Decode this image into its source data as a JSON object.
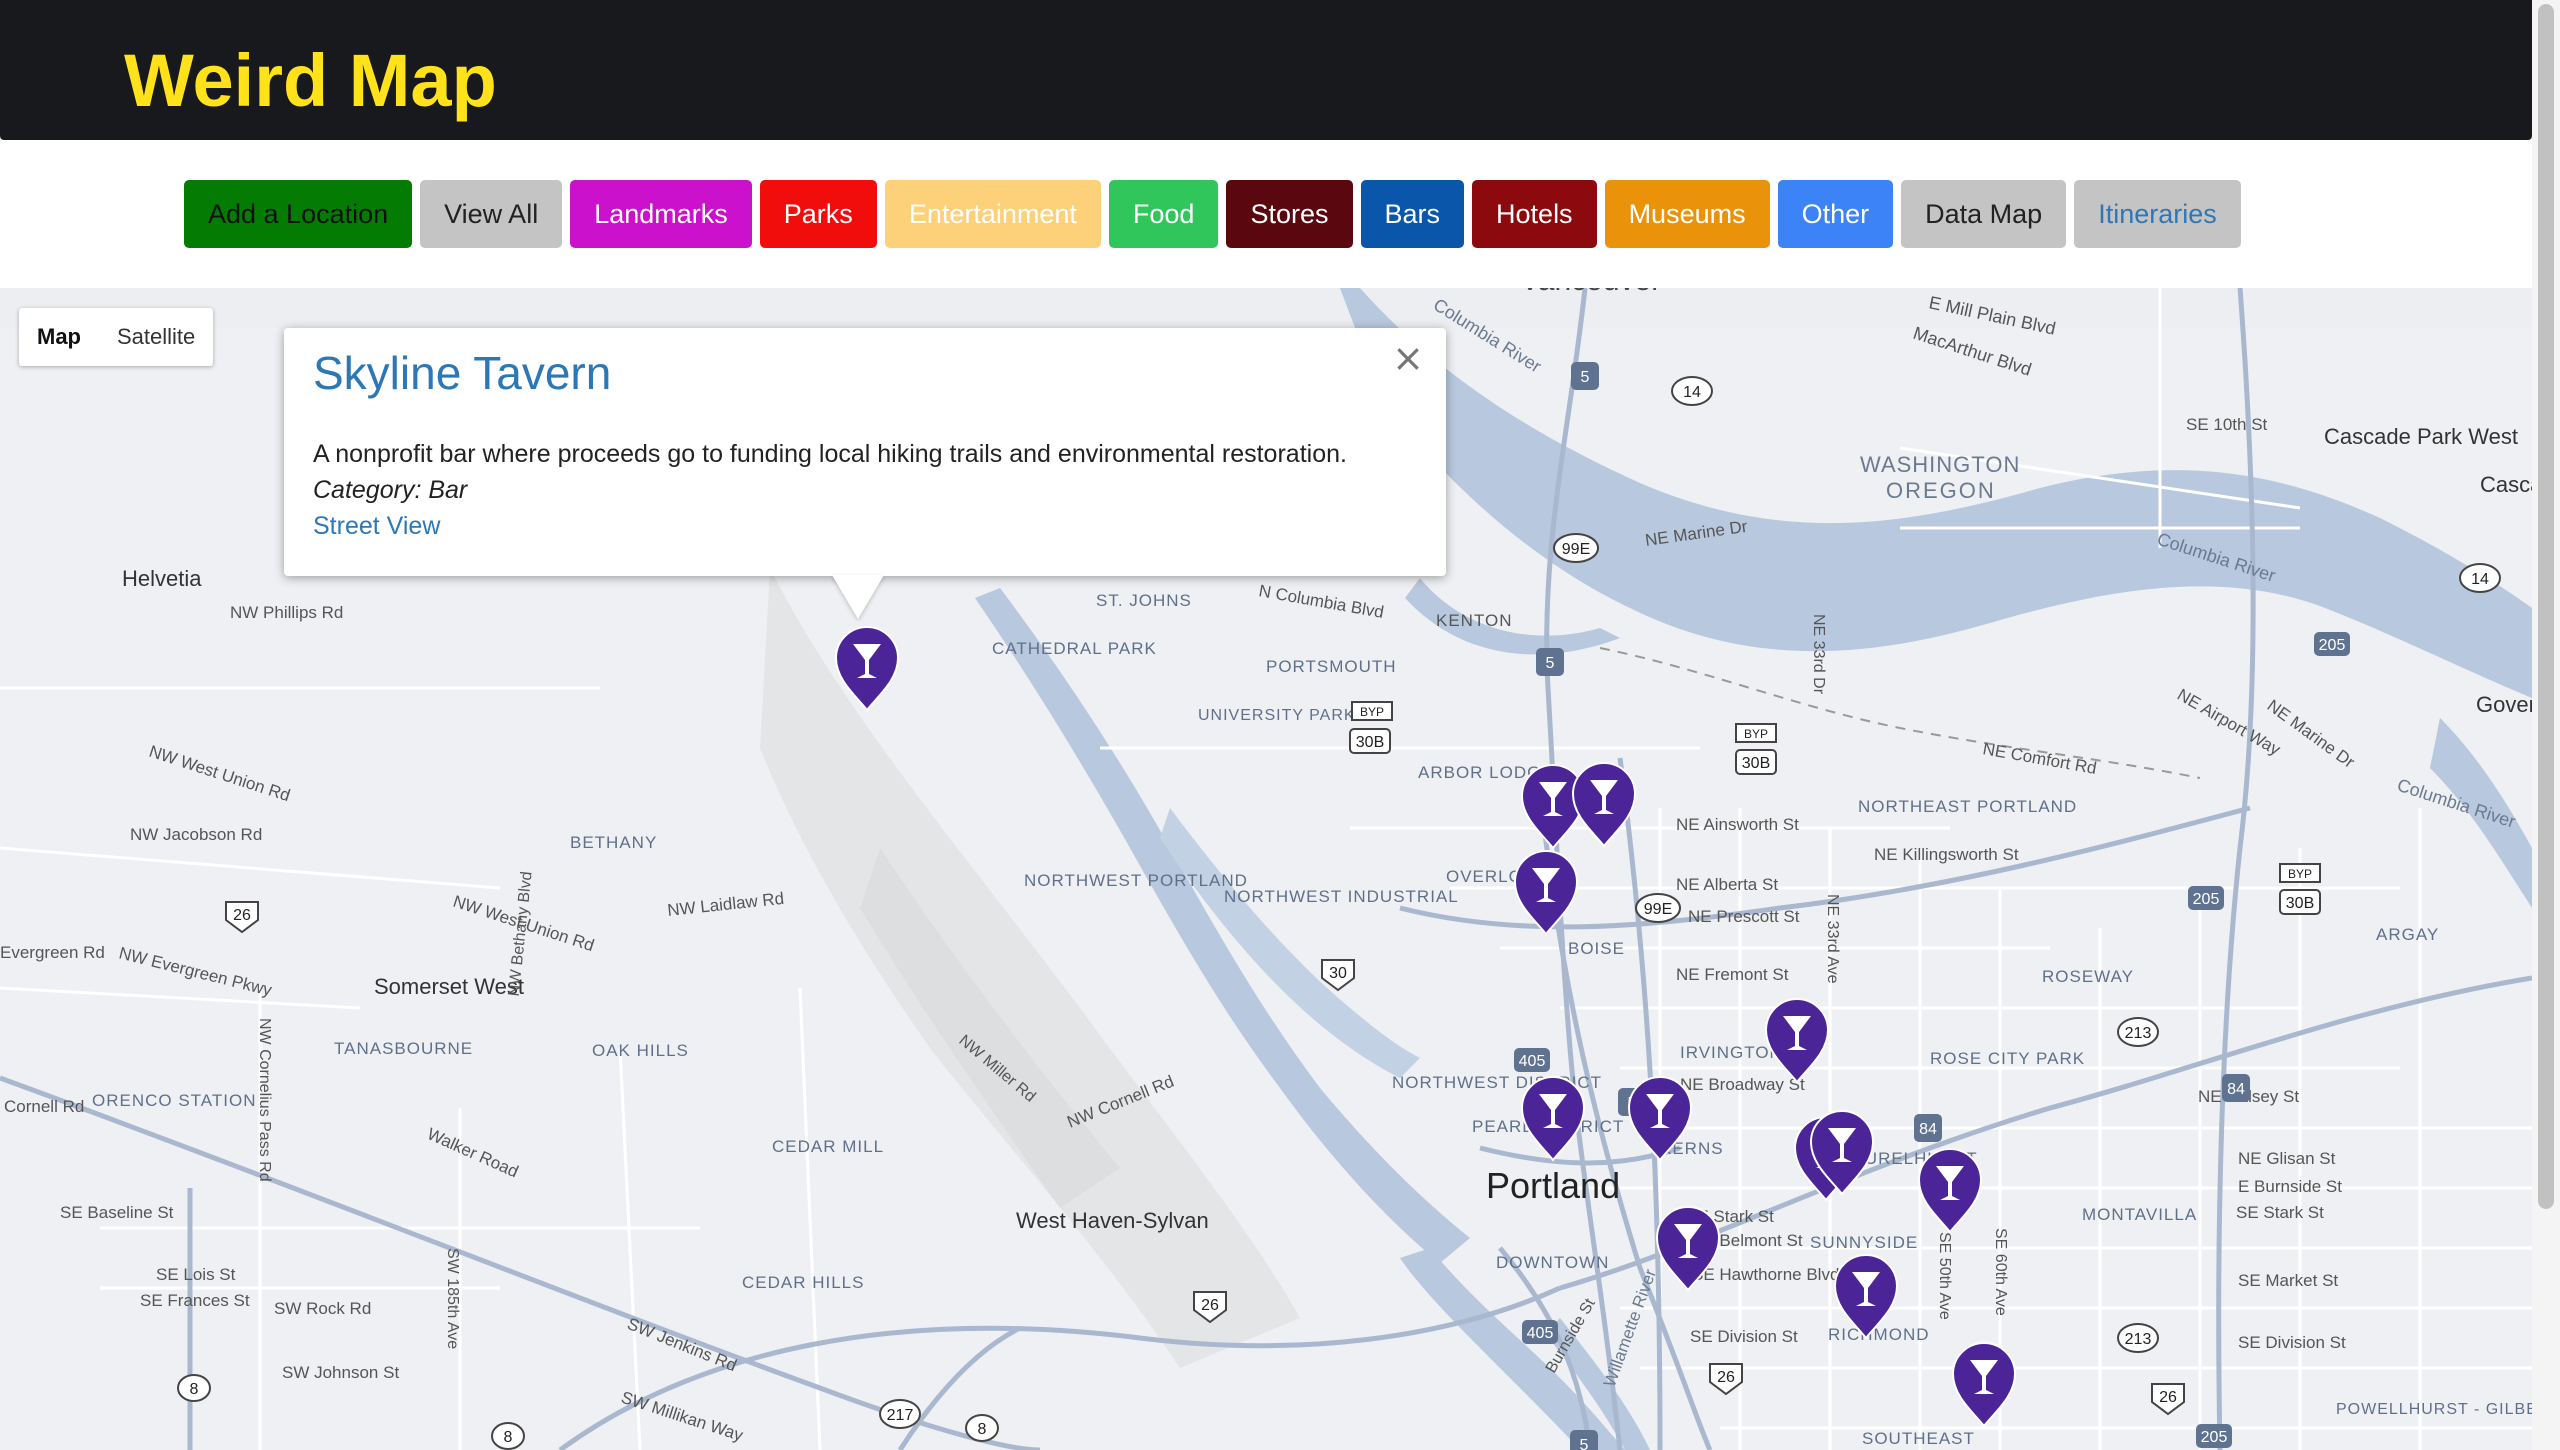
{
  "header": {
    "title": "Weird Map"
  },
  "nav": [
    {
      "label": "Add a Location",
      "bg": "#047c04",
      "fg": "#111111"
    },
    {
      "label": "View All",
      "bg": "#c4c4c4",
      "fg": "#222222"
    },
    {
      "label": "Landmarks",
      "bg": "#cc11cc",
      "fg": "#ffffff"
    },
    {
      "label": "Parks",
      "bg": "#f20d0d",
      "fg": "#ffffff"
    },
    {
      "label": "Entertainment",
      "bg": "#fdd07a",
      "fg": "#ffffff"
    },
    {
      "label": "Food",
      "bg": "#31c65b",
      "fg": "#ffffff"
    },
    {
      "label": "Stores",
      "bg": "#5a0710",
      "fg": "#ffffff"
    },
    {
      "label": "Bars",
      "bg": "#0a56aa",
      "fg": "#ffffff"
    },
    {
      "label": "Hotels",
      "bg": "#8c0a0e",
      "fg": "#ffffff"
    },
    {
      "label": "Museums",
      "bg": "#ea920a",
      "fg": "#ffffff"
    },
    {
      "label": "Other",
      "bg": "#3b83f6",
      "fg": "#ffffff"
    },
    {
      "label": "Data Map",
      "bg": "#c4c4c4",
      "fg": "#222222"
    },
    {
      "label": "Itineraries",
      "bg": "#c4c4c4",
      "fg": "#2c78b7"
    }
  ],
  "map": {
    "map_type": {
      "map": "Map",
      "satellite": "Satellite"
    },
    "popup": {
      "title": "Skyline Tavern",
      "description": "A nonprofit bar where proceeds go to funding local hiking trails and environmental restoration.",
      "category": "Category: Bar",
      "link": "Street View"
    },
    "labels": [
      "Vancouver",
      "E Mill Plain Blvd",
      "MacArthur Blvd",
      "SE 10th St",
      "Cascade Park West",
      "Cascade Park E",
      "WASHINGTON",
      "OREGON",
      "Columbia River",
      "Columbia River",
      "Columbia River",
      "NE Marine Dr",
      "Helvetia",
      "NW Phillips Rd",
      "N Columbia Blvd",
      "KENTON",
      "NE 33rd Dr",
      "ST. JOHNS",
      "CATHEDRAL PARK",
      "PORTSMOUTH",
      "UNIVERSITY PARK",
      "NE Airport Way",
      "NE Marine Dr",
      "Government Island",
      "NE Comfort Rd",
      "NW West Union Rd",
      "ARBOR LODGE",
      "NE Ainsworth St",
      "NORTHEAST PORTLAND",
      "NE Killingsworth St",
      "NW Jacobson Rd",
      "BETHANY",
      "OVERLOOK",
      "NE Alberta St",
      "NE Prescott St",
      "NORTHWEST PORTLAND",
      "NORTHWEST INDUSTRIAL",
      "NW West Union Rd",
      "NW Laidlaw Rd",
      "BOISE",
      "NE 33rd Ave",
      "ARGAY",
      "Evergreen Rd",
      "NW Evergreen Pkwy",
      "Somerset West",
      "NW Bethany Blvd",
      "NE Fremont St",
      "ROSEWAY",
      "TANASBOURNE",
      "OAK HILLS",
      "NW Cornelius Pass Rd",
      "NW Miller Rd",
      "IRVINGTON",
      "ROSE CITY PARK",
      "Cornell Rd",
      "ORENCO STATION",
      "NW Cornell Rd",
      "NE Broadway St",
      "NORTHWEST DISTRICT",
      "NE Halsey St",
      "Walker Road",
      "PEARL DISTRICT",
      "KERNS",
      "LAURELHURST",
      "NE Glisan St",
      "CEDAR MILL",
      "Portland",
      "E Burnside St",
      "SE Baseline St",
      "SE Stark St",
      "SE Belmont St",
      "SUNNYSIDE",
      "MONTAVILLA",
      "SE Stark St",
      "West Haven-Sylvan",
      "DOWNTOWN",
      "SE Hawthorne Blvd",
      "SE Lois St",
      "SW 185th Ave",
      "SE 50th Ave",
      "SE 60th Ave",
      "SE Market St",
      "SE Frances St",
      "SW Rock Rd",
      "CEDAR HILLS",
      "SE Division St",
      "RICHMOND",
      "SE Division St",
      "SW Jenkins Rd",
      "SW Johnson St",
      "SW Millikan Way",
      "POWELLHURST - GILBERT",
      "SOUTHEAST",
      "Willamette River",
      "Burnside St"
    ],
    "shields": [
      "5",
      "14",
      "99E",
      "5",
      "14",
      "205",
      "BYP",
      "30B",
      "BYP",
      "30B",
      "BYP",
      "30B",
      "205",
      "26",
      "99E",
      "30",
      "405",
      "5",
      "213",
      "84",
      "84",
      "405",
      "26",
      "26",
      "213",
      "26",
      "205",
      "8",
      "8",
      "217",
      "8",
      "5"
    ],
    "markers": [
      "bar-marker"
    ]
  }
}
